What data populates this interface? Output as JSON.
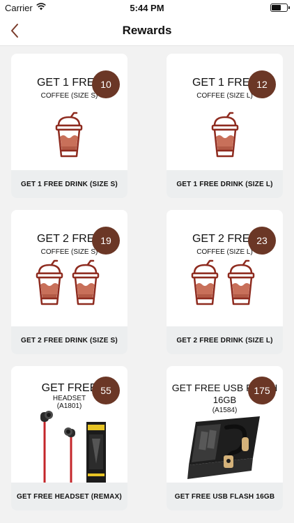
{
  "status_bar": {
    "carrier": "Carrier",
    "time": "5:44 PM"
  },
  "nav": {
    "title": "Rewards"
  },
  "colors": {
    "accent": "#6b3726",
    "drink_body": "#c8705a",
    "outline": "#8e2b1f"
  },
  "rewards": [
    {
      "title": "GET 1 FREE",
      "subtitle": "COFFEE (SIZE S)",
      "points": "10",
      "button": "GET 1 FREE DRINK (SIZE S)",
      "icon": "coffee-cup-icon"
    },
    {
      "title": "GET 1 FREE",
      "subtitle": "COFFEE (SIZE L)",
      "points": "12",
      "button": "GET 1 FREE DRINK (SIZE L)",
      "icon": "coffee-cup-icon"
    },
    {
      "title": "GET 2 FREE",
      "subtitle": "COFFEE (SIZE S)",
      "points": "19",
      "button": "GET 2 FREE DRINK (SIZE S)",
      "icon": "coffee-cup-icon"
    },
    {
      "title": "GET 2 FREE",
      "subtitle": "COFFEE (SIZE L)",
      "points": "23",
      "button": "GET 2 FREE DRINK (SIZE L)",
      "icon": "coffee-cup-icon"
    },
    {
      "title": "GET FREE",
      "subtitle": "HEADSET",
      "code": "(A1801)",
      "points": "55",
      "button": "GET FREE HEADSET (REMAX)",
      "icon": "headset-image"
    },
    {
      "title": "GET FREE USB FLASH",
      "subtitle": "16GB",
      "code": "(A1584)",
      "points": "175",
      "button": "GET FREE USB FLASH 16GB",
      "icon": "usb-flash-image"
    }
  ]
}
